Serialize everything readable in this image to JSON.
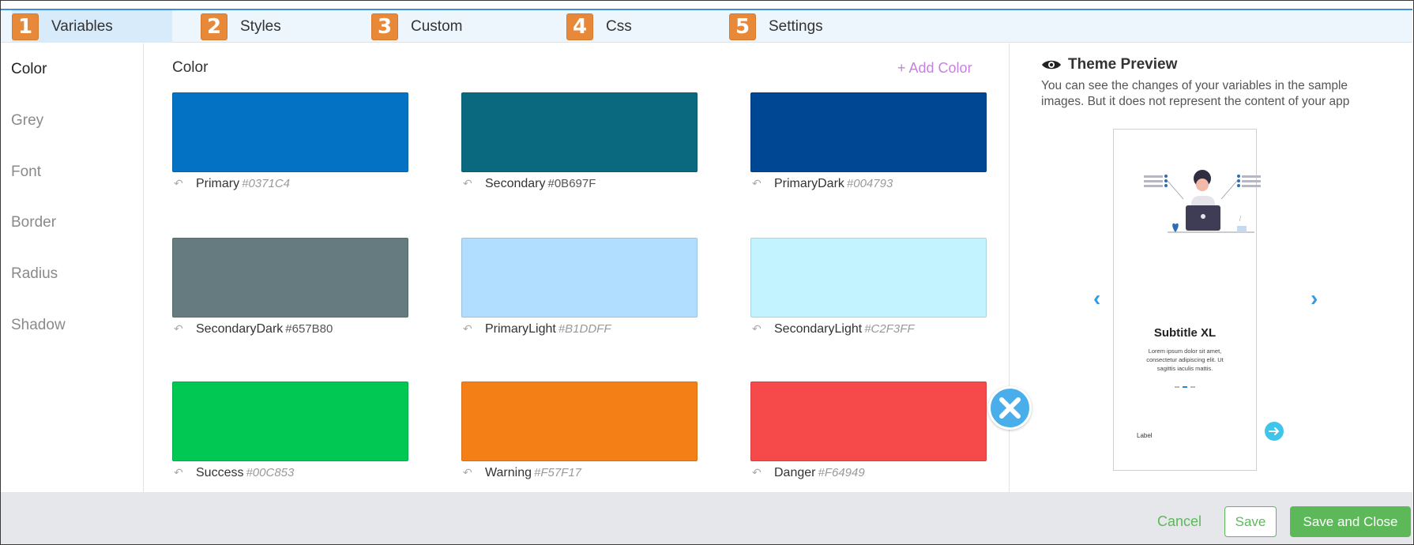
{
  "tabs": [
    {
      "num": "1",
      "label": "Variables"
    },
    {
      "num": "2",
      "label": "Styles"
    },
    {
      "num": "3",
      "label": "Custom"
    },
    {
      "num": "4",
      "label": "Css"
    },
    {
      "num": "5",
      "label": "Settings"
    }
  ],
  "menu": [
    "Color",
    "Grey",
    "Font",
    "Border",
    "Radius",
    "Shadow"
  ],
  "main": {
    "title": "Color",
    "add_label": "+ Add Color",
    "colors": [
      {
        "name": "Primary",
        "hex": "#0371C4",
        "color": "#0371c4"
      },
      {
        "name": "Secondary",
        "hex": "#0B697F",
        "color": "#0b697f"
      },
      {
        "name": "PrimaryDark",
        "hex": "#004793",
        "color": "#004793"
      },
      {
        "name": "SecondaryDark",
        "hex": "#657B80",
        "color": "#657b80"
      },
      {
        "name": "PrimaryLight",
        "hex": "#B1DDFF",
        "color": "#b1ddff"
      },
      {
        "name": "SecondaryLight",
        "hex": "#C2F3FF",
        "color": "#c2f3ff"
      },
      {
        "name": "Success",
        "hex": "#00C853",
        "color": "#00c853"
      },
      {
        "name": "Warning",
        "hex": "#F57F17",
        "color": "#f57f17"
      },
      {
        "name": "Danger",
        "hex": "#F64949",
        "color": "#f64949"
      }
    ]
  },
  "preview": {
    "title": "Theme Preview",
    "description": "You can see the changes of your variables in the sample images. But it does not represent the content of your app",
    "phone": {
      "subtitle": "Subtitle XL",
      "body": "Lorem ipsum dolor sit amet, consectetur adipiscing elit. Ut sagittis iaculis mattis.",
      "label": "Label"
    }
  },
  "footer": {
    "cancel": "Cancel",
    "save": "Save",
    "save_close": "Save and Close"
  },
  "colors": {
    "tab_accent": "#e8893a",
    "link": "#3a9be0",
    "green": "#5db85a",
    "add_color": "#c682e0"
  }
}
